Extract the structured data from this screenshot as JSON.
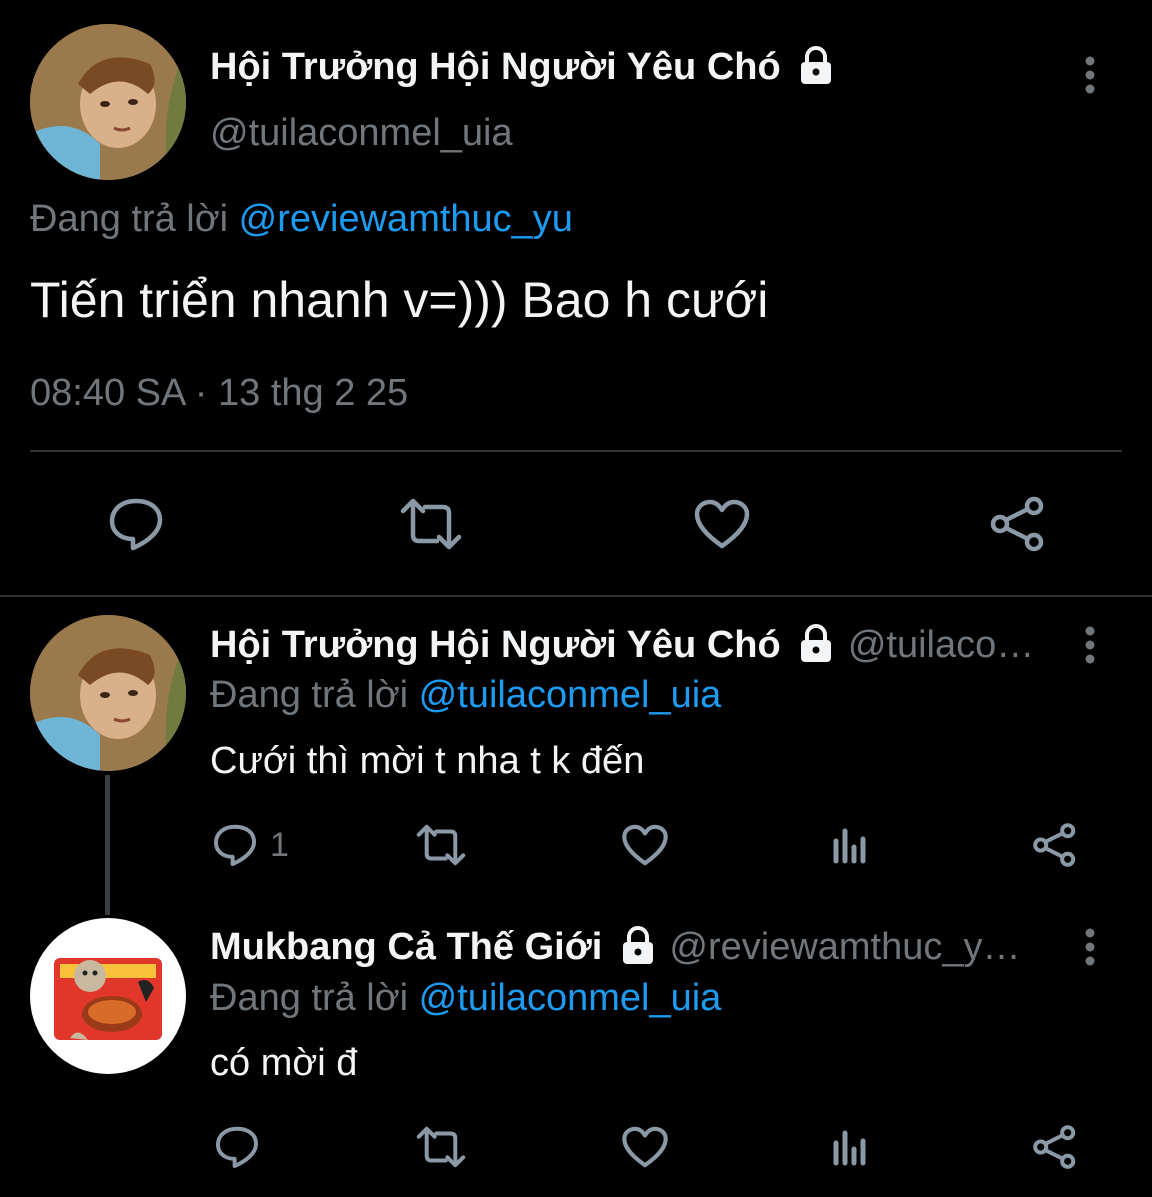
{
  "main_tweet": {
    "display_name": "Hội Trưởng Hội Người Yêu Chó",
    "handle": "@tuilaconmel_uia",
    "replying_prefix": "Đang trả lời",
    "replying_to": "@reviewamthuc_yu",
    "text": "Tiến triển nhanh v=))) Bao h cưới",
    "timestamp": "08:40 SA · 13 thg 2 25",
    "actions": [
      "reply-icon",
      "retweet-icon",
      "like-icon",
      "share-icon"
    ]
  },
  "replies": [
    {
      "display_name": "Hội Trưởng Hội Người Yêu Chó",
      "handle": "@tuilaco…",
      "replying_prefix": "Đang trả lời",
      "replying_to": "@tuilaconmel_uia",
      "text": "Cưới thì mời t nha t k đến",
      "reply_count": "1"
    },
    {
      "display_name": "Mukbang Cả Thế Giới",
      "handle": "@reviewamthuc_y…",
      "replying_prefix": "Đang trả lời",
      "replying_to": "@tuilaconmel_uia",
      "text": "có mời đ",
      "reply_count": ""
    }
  ],
  "colors": {
    "background": "#000000",
    "text": "#e7e9ea",
    "muted": "#71767b",
    "link": "#1d9bf0",
    "divider": "#2f3336"
  }
}
